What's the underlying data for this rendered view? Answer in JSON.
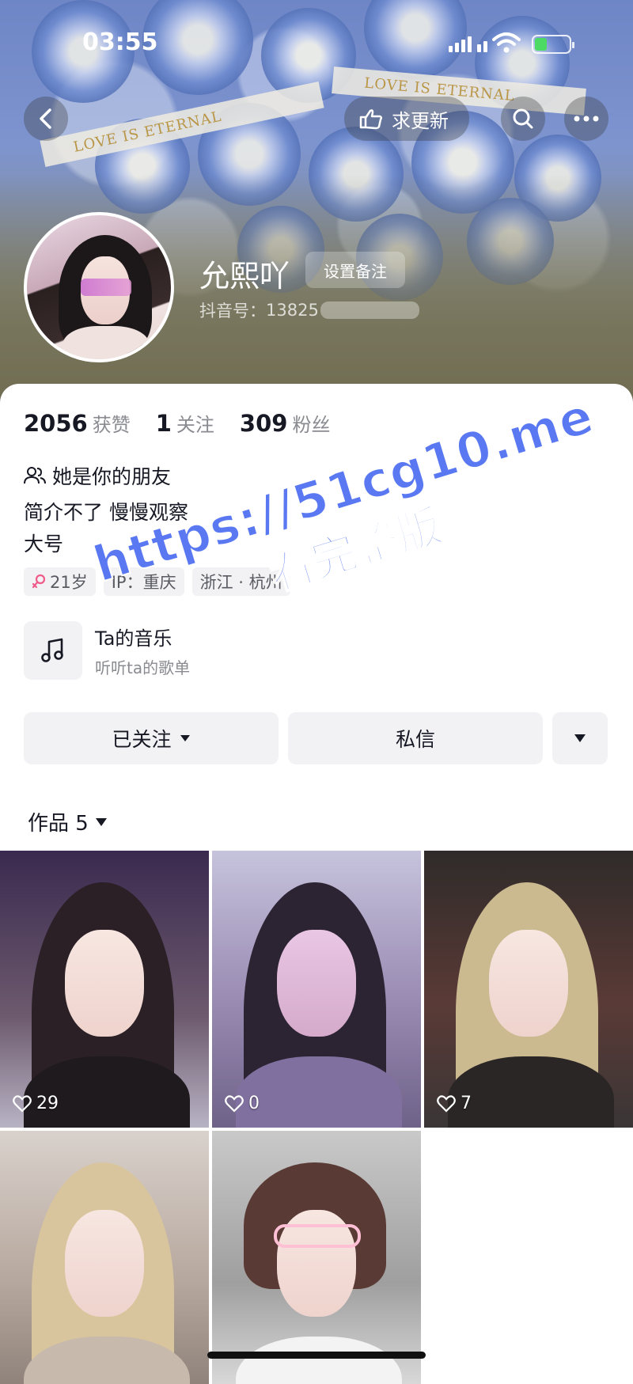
{
  "status_bar": {
    "time": "03:55"
  },
  "banner": {
    "ribbon_texts": [
      "LOVE IS ETERNAL",
      "LOVE IS ETERNAL"
    ],
    "request_update_label": "求更新"
  },
  "profile": {
    "nickname": "允熙吖",
    "set_remark_label": "设置备注",
    "douyin_id_label": "抖音号：",
    "douyin_id_value": "13825"
  },
  "stats": [
    {
      "value": "2056",
      "label": "获赞"
    },
    {
      "value": "1",
      "label": "关注"
    },
    {
      "value": "309",
      "label": "粉丝"
    }
  ],
  "friend_text": "她是你的朋友",
  "bio_lines": [
    "简介不了 慢慢观察",
    "大号"
  ],
  "tags": {
    "age": "21岁",
    "ip": "IP：重庆",
    "location": "浙江 · 杭州"
  },
  "music": {
    "title": "Ta的音乐",
    "subtitle": "听听ta的歌单"
  },
  "actions": {
    "follow": "已关注",
    "message": "私信"
  },
  "works_tab": {
    "label": "作品 5"
  },
  "works": [
    {
      "likes": "29"
    },
    {
      "likes": "0"
    },
    {
      "likes": "7"
    },
    {
      "likes": ""
    },
    {
      "likes": ""
    }
  ],
  "watermark": {
    "line1": "https://51cg10.me",
    "line2": "看完整版"
  },
  "colors": {
    "accent_watermark": "#4d6ef0",
    "text_primary": "#161823",
    "text_secondary": "#8a8b91",
    "chip_bg": "#f2f2f4"
  },
  "icons": [
    "back-arrow-icon",
    "hand-point-icon",
    "search-icon",
    "more-icon",
    "friends-icon",
    "female-icon",
    "music-note-icon",
    "caret-down-icon",
    "heart-icon"
  ]
}
